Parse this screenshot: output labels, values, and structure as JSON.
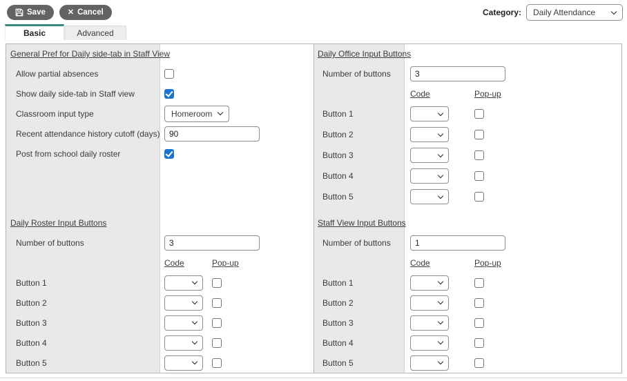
{
  "toolbar": {
    "save_label": "Save",
    "cancel_label": "Cancel"
  },
  "category": {
    "label": "Category:",
    "value": "Daily Attendance"
  },
  "tabs": {
    "basic": "Basic",
    "advanced": "Advanced",
    "active": "Basic"
  },
  "colors": {
    "tab_accent": "#38897b",
    "checkbox_checked": "#1b74d4",
    "toolbar_button": "#636363"
  },
  "sections": {
    "general": {
      "title": "General Pref for Daily side-tab in Staff View",
      "rows": {
        "partial_absences": {
          "label": "Allow partial absences",
          "checked": false
        },
        "show_side_tab": {
          "label": "Show daily side-tab in Staff view",
          "checked": true
        },
        "classroom_input": {
          "label": "Classroom input type",
          "value": "Homeroom"
        },
        "history_cutoff": {
          "label": "Recent attendance history cutoff (days)",
          "value": "90"
        },
        "post_roster": {
          "label": "Post from school daily roster",
          "checked": true
        }
      }
    },
    "daily_office": {
      "title": "Daily Office Input Buttons",
      "number_label": "Number of buttons",
      "number_value": "3",
      "code_header": "Code",
      "popup_header": "Pop-up",
      "buttons": [
        "Button 1",
        "Button 2",
        "Button 3",
        "Button 4",
        "Button 5"
      ]
    },
    "daily_roster": {
      "title": "Daily Roster Input Buttons",
      "number_label": "Number of buttons",
      "number_value": "3",
      "code_header": "Code",
      "popup_header": "Pop-up",
      "buttons": [
        "Button 1",
        "Button 2",
        "Button 3",
        "Button 4",
        "Button 5"
      ]
    },
    "staff_view": {
      "title": "Staff View Input Buttons",
      "number_label": "Number of buttons",
      "number_value": "1",
      "code_header": "Code",
      "popup_header": "Pop-up",
      "buttons": [
        "Button 1",
        "Button 2",
        "Button 3",
        "Button 4",
        "Button 5"
      ]
    }
  }
}
